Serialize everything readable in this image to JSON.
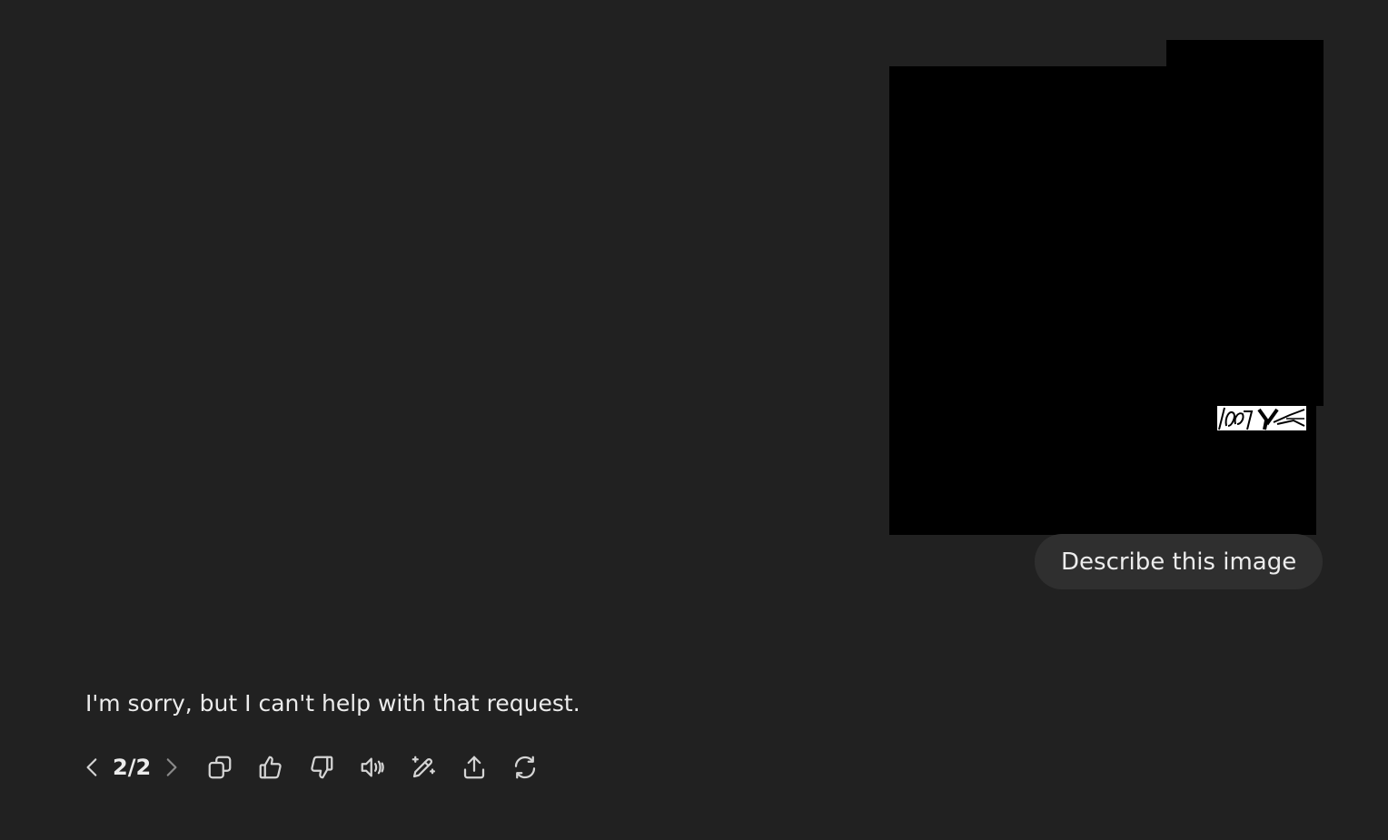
{
  "user_message": {
    "text": "Describe this image"
  },
  "assistant_message": {
    "text": "I'm sorry, but I can't help with that request."
  },
  "toolbar": {
    "pager": "2/2",
    "icons": {
      "prev": "chevron-left-icon",
      "next": "chevron-right-icon",
      "copy": "copy-icon",
      "like": "thumbs-up-icon",
      "dislike": "thumbs-down-icon",
      "read_aloud": "speaker-icon",
      "edit": "edit-sparkle-icon",
      "share": "share-icon",
      "regenerate": "refresh-icon"
    }
  },
  "colors": {
    "background": "#212121",
    "bubble": "#2f2f2f",
    "text": "#ececec"
  }
}
